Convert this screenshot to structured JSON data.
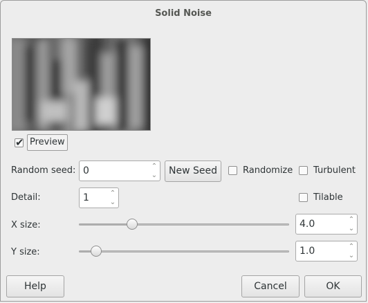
{
  "window": {
    "title": "Solid Noise"
  },
  "preview": {
    "label": "Preview",
    "checked": true
  },
  "seed": {
    "label": "Random seed:",
    "value": "0",
    "new_seed_label": "New Seed"
  },
  "randomize": {
    "label": "Randomize",
    "checked": false
  },
  "turbulent": {
    "label": "Turbulent",
    "checked": false
  },
  "detail": {
    "label": "Detail:",
    "value": "1"
  },
  "tilable": {
    "label": "Tilable",
    "checked": false
  },
  "x_size": {
    "label": "X size:",
    "value": "4.0",
    "fraction": 0.25
  },
  "y_size": {
    "label": "Y size:",
    "value": "1.0",
    "fraction": 0.08
  },
  "buttons": {
    "help": "Help",
    "cancel": "Cancel",
    "ok": "OK"
  },
  "icons": {
    "check": "checkmark-icon",
    "up": "chevron-up-icon",
    "down": "chevron-down-icon"
  }
}
